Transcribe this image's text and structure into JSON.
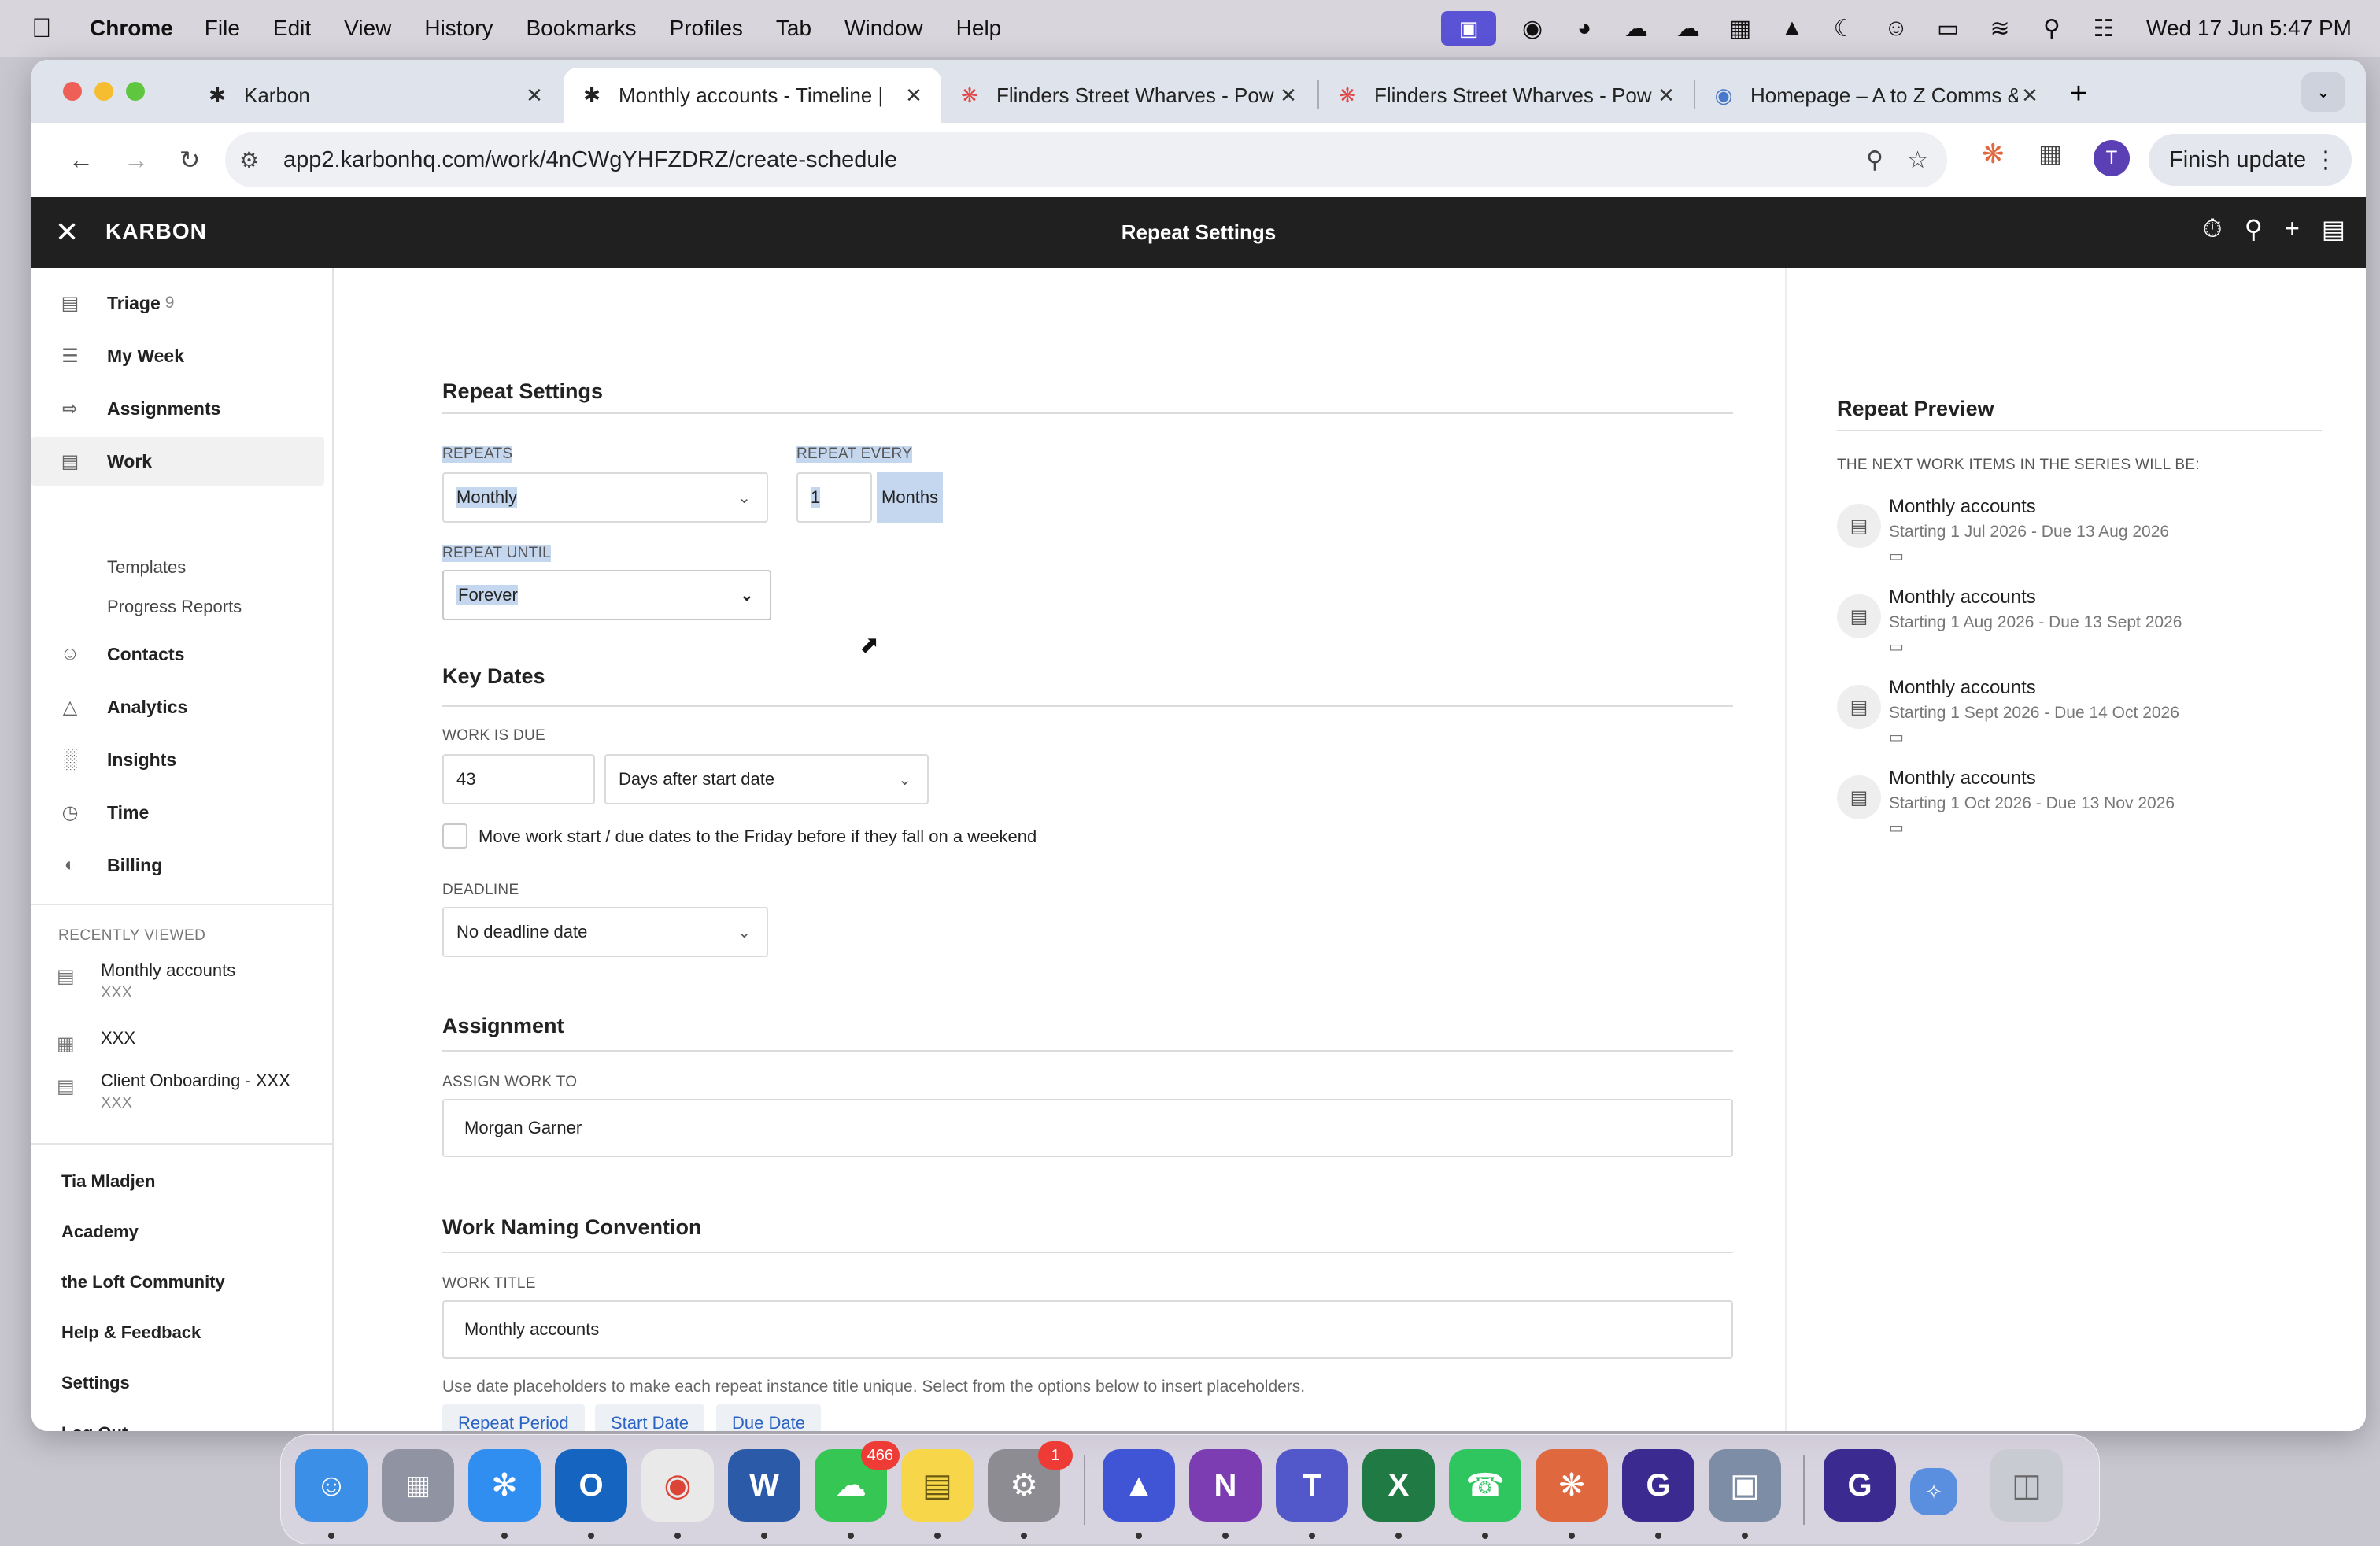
{
  "menubar": {
    "app_name": "Chrome",
    "items": [
      "File",
      "Edit",
      "View",
      "History",
      "Bookmarks",
      "Profiles",
      "Tab",
      "Window",
      "Help"
    ],
    "clock": "Wed 17 Jun  5:47 PM"
  },
  "tabs": [
    {
      "title": "Karbon",
      "icon": "karbon-icon"
    },
    {
      "title": "Monthly accounts - Timeline |",
      "icon": "karbon-icon"
    },
    {
      "title": "Flinders Street Wharves - Pow",
      "icon": "asterisk-icon"
    },
    {
      "title": "Flinders Street Wharves - Pow",
      "icon": "asterisk-icon"
    },
    {
      "title": "Homepage – A to Z Comms &",
      "icon": "globe-icon"
    }
  ],
  "toolbar": {
    "url": "app2.karbonhq.com/work/4nCWgYHFZDRZ/create-schedule",
    "profile_initial": "T",
    "finish_update": "Finish update"
  },
  "appbar": {
    "brand": "KARBON",
    "title": "Repeat Settings"
  },
  "sidebar": {
    "items": [
      {
        "label": "Triage",
        "count": "9",
        "icon": "triage-icon"
      },
      {
        "label": "My Week",
        "icon": "list-icon"
      },
      {
        "label": "Assignments",
        "icon": "assignments-icon"
      },
      {
        "label": "Work",
        "icon": "briefcase-icon"
      },
      {
        "label": "Contacts",
        "icon": "contacts-icon"
      },
      {
        "label": "Analytics",
        "icon": "analytics-icon"
      },
      {
        "label": "Insights",
        "icon": "bar-chart-icon"
      },
      {
        "label": "Time",
        "icon": "clock-icon"
      },
      {
        "label": "Billing",
        "icon": "billing-icon"
      }
    ],
    "sub_items": [
      "Templates",
      "Progress Reports"
    ],
    "recently_viewed_title": "RECENTLY VIEWED",
    "recent": [
      {
        "name": "Monthly accounts",
        "sub": "XXX",
        "icon": "briefcase-icon"
      },
      {
        "name": "XXX",
        "sub": "",
        "icon": "building-icon"
      },
      {
        "name": "Client Onboarding - XXX",
        "sub": "XXX",
        "icon": "briefcase-icon"
      }
    ],
    "links": [
      "Tia Mladjen",
      "Academy",
      "the Loft Community",
      "Help & Feedback",
      "Settings",
      "Log Out"
    ]
  },
  "form": {
    "repeat_settings": {
      "title": "Repeat Settings",
      "repeats_label": "REPEATS",
      "repeats_value": "Monthly",
      "repeat_every_label": "REPEAT EVERY",
      "repeat_every_value": "1",
      "repeat_every_unit": "Months",
      "repeat_until_label": "REPEAT UNTIL",
      "repeat_until_value": "Forever"
    },
    "key_dates": {
      "title": "Key Dates",
      "work_due_label": "WORK IS DUE",
      "work_due_value": "43",
      "work_due_mode": "Days after start date",
      "weekend_checkbox_label": "Move work start / due dates to the Friday before if they fall on a weekend",
      "deadline_label": "DEADLINE",
      "deadline_value": "No deadline date"
    },
    "assignment": {
      "title": "Assignment",
      "assign_label": "ASSIGN WORK TO",
      "assign_value": "Morgan Garner"
    },
    "naming": {
      "title": "Work Naming Convention",
      "work_title_label": "WORK TITLE",
      "work_title_value": "Monthly accounts",
      "help": "Use date placeholders to make each repeat instance title unique. Select from the options below to insert placeholders.",
      "buttons": [
        "Repeat Period",
        "Start Date",
        "Due Date"
      ]
    }
  },
  "preview": {
    "title": "Repeat Preview",
    "label": "THE NEXT WORK ITEMS IN THE SERIES WILL BE:",
    "items": [
      {
        "name": "Monthly accounts",
        "dates": "Starting 1 Jul 2026 - Due 13 Aug 2026"
      },
      {
        "name": "Monthly accounts",
        "dates": "Starting 1 Aug 2026 - Due 13 Sept 2026"
      },
      {
        "name": "Monthly accounts",
        "dates": "Starting 1 Sept 2026 - Due 14 Oct 2026"
      },
      {
        "name": "Monthly accounts",
        "dates": "Starting 1 Oct 2026 - Due 13 Nov 2026"
      }
    ]
  },
  "dock": {
    "messages_badge": "466",
    "settings_badge": "1"
  },
  "colors": {
    "appbar_bg": "#202020",
    "link_blue": "#2b63c5",
    "selection": "#c5d6ef"
  }
}
